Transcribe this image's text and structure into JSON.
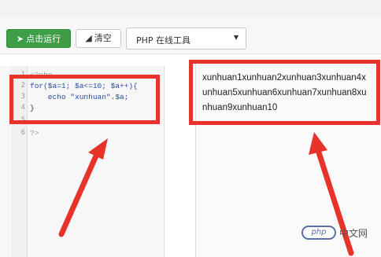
{
  "toolbar": {
    "run_label": "点击运行",
    "clear_label": "清空",
    "language_select": "PHP 在线工具"
  },
  "editor": {
    "line_numbers": [
      "1",
      "2",
      "3",
      "4",
      "5",
      "6"
    ],
    "lines": [
      "<?php",
      "for($a=1; $a<=10; $a++){",
      "    echo \"xunhuan\".$a;",
      "}",
      "",
      "?>"
    ]
  },
  "result": {
    "output": "xunhuan1xunhuan2xunhuan3xunhuan4xunhuan5xunhuan6xunhuan7xunhuan8xunhuan9xunhuan10"
  },
  "watermark": {
    "badge": "php",
    "text": "中文网"
  },
  "colors": {
    "run_button": "#3e9e46",
    "highlight": "#e8332a"
  },
  "icons": {
    "run": "send-icon",
    "clear": "eraser-icon",
    "select": "caret-down-icon"
  }
}
